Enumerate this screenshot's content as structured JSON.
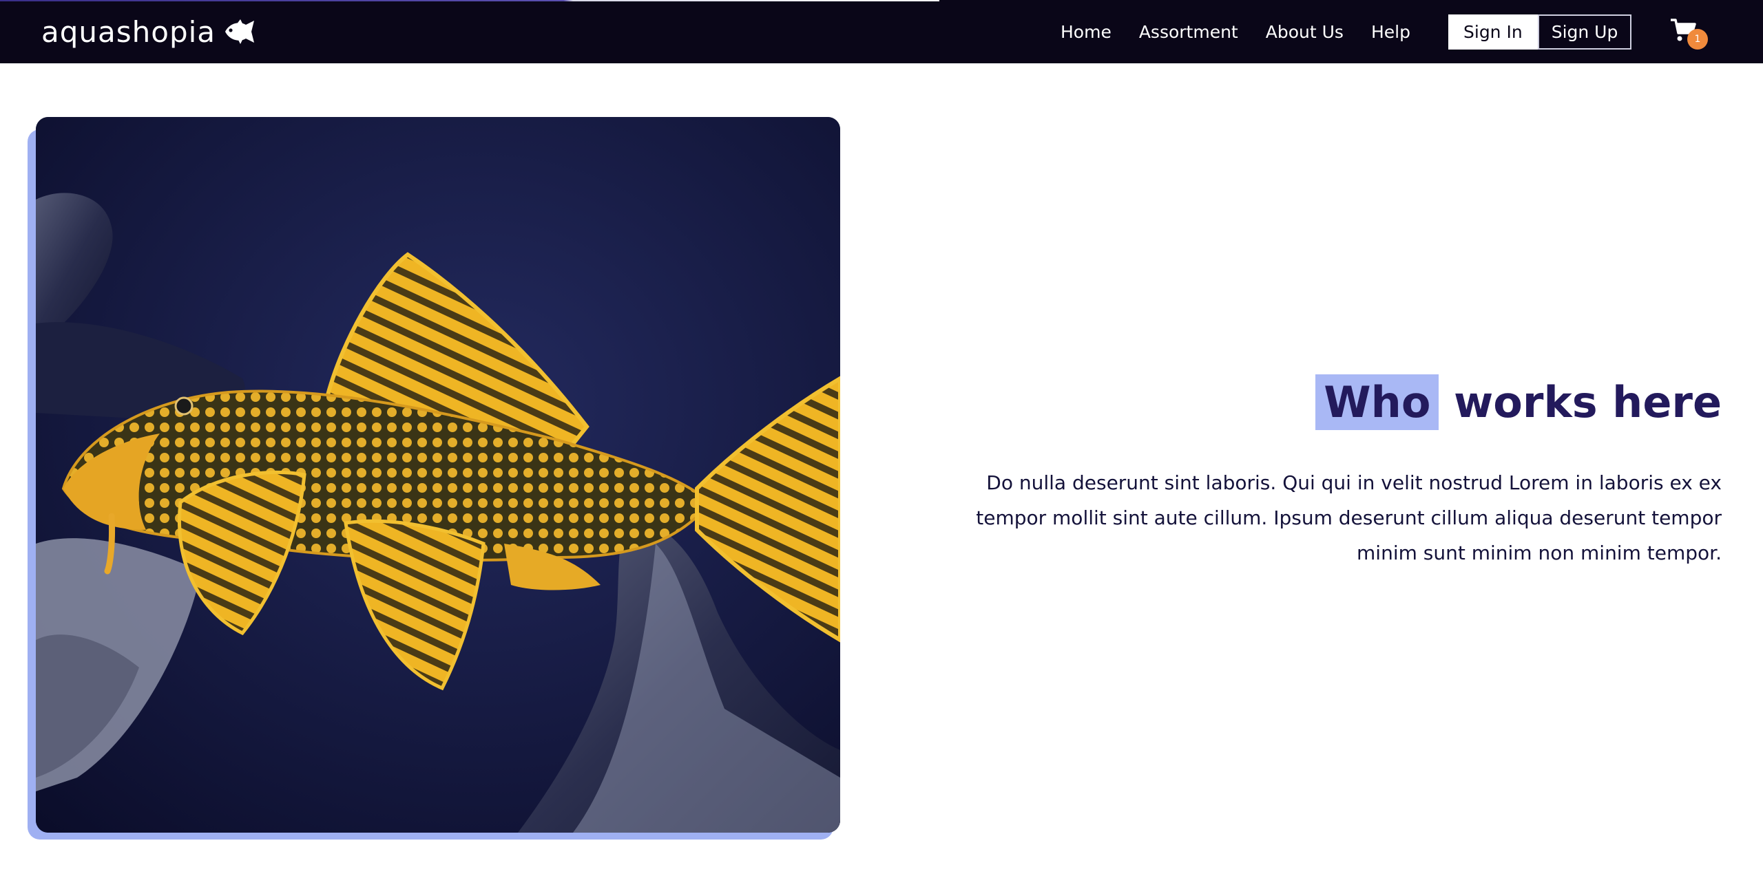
{
  "header": {
    "brand": "aquashopia",
    "brand_icon": "fish-icon",
    "nav": [
      {
        "label": "Home"
      },
      {
        "label": "Assortment"
      },
      {
        "label": "About Us"
      },
      {
        "label": "Help"
      }
    ],
    "auth": {
      "sign_in": "Sign In",
      "sign_up": "Sign Up"
    },
    "cart": {
      "icon": "cart-icon",
      "count": "1"
    }
  },
  "main": {
    "photo": {
      "subject": "pleco-fish-photo"
    },
    "heading": {
      "highlight": "Who",
      "rest": "works here"
    },
    "paragraph": "Do nulla deserunt sint laboris. Qui qui in velit nostrud Lorem in laboris ex ex tempor mollit sint aute cillum. Ipsum deserunt cillum aliqua deserunt tempor minim sunt minim non minim tempor."
  },
  "colors": {
    "navbar_bg": "#0a0618",
    "heading": "#231a5c",
    "highlight": "#a9b8f5",
    "badge": "#f08a3c",
    "photo_shadow": "#9fb0f2"
  }
}
